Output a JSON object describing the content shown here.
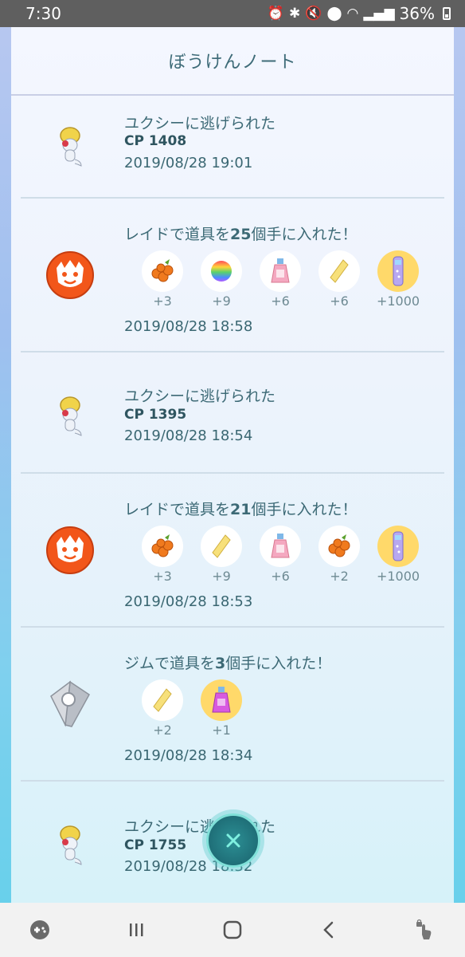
{
  "status_bar": {
    "time": "7:30",
    "battery": "36%"
  },
  "header": {
    "title": "ぼうけんノート"
  },
  "entries": [
    {
      "kind": "flee",
      "title": "ユクシーに逃げられた",
      "cp": "CP 1408",
      "time": "2019/08/28 19:01"
    },
    {
      "kind": "raid",
      "title_prefix": "レイドで道具を",
      "title_num": "25",
      "title_suffix": "個手に入れた！",
      "items": [
        {
          "icon": "nanab-berry-icon",
          "count": "+3"
        },
        {
          "icon": "rare-candy-icon",
          "count": "+9"
        },
        {
          "icon": "max-revive-potion-icon",
          "count": "+6"
        },
        {
          "icon": "golden-crystal-icon",
          "count": "+6"
        },
        {
          "icon": "stardust-tube-icon",
          "count": "+1000"
        }
      ],
      "time": "2019/08/28 18:58"
    },
    {
      "kind": "flee",
      "title": "ユクシーに逃げられた",
      "cp": "CP 1395",
      "time": "2019/08/28 18:54"
    },
    {
      "kind": "raid",
      "title_prefix": "レイドで道具を",
      "title_num": "21",
      "title_suffix": "個手に入れた！",
      "items": [
        {
          "icon": "nanab-berry-icon",
          "count": "+3"
        },
        {
          "icon": "golden-crystal-icon",
          "count": "+9"
        },
        {
          "icon": "max-revive-potion-icon",
          "count": "+6"
        },
        {
          "icon": "nanab-berry-icon",
          "count": "+2"
        },
        {
          "icon": "stardust-tube-icon",
          "count": "+1000"
        }
      ],
      "time": "2019/08/28 18:53"
    },
    {
      "kind": "gym",
      "title_prefix": "ジムで道具を",
      "title_num": "3",
      "title_suffix": "個手に入れた！",
      "items": [
        {
          "icon": "golden-crystal-icon",
          "count": "+2"
        },
        {
          "icon": "potion-icon",
          "count": "+1"
        }
      ],
      "time": "2019/08/28 18:34"
    },
    {
      "kind": "flee",
      "title": "ユクシーに逃げられた",
      "cp": "CP 1755",
      "time": "2019/08/28 18:32"
    }
  ],
  "colors": {
    "accent": "#3d6a76",
    "raid_orange": "#f2561a",
    "item_gold": "#ffd96a"
  }
}
